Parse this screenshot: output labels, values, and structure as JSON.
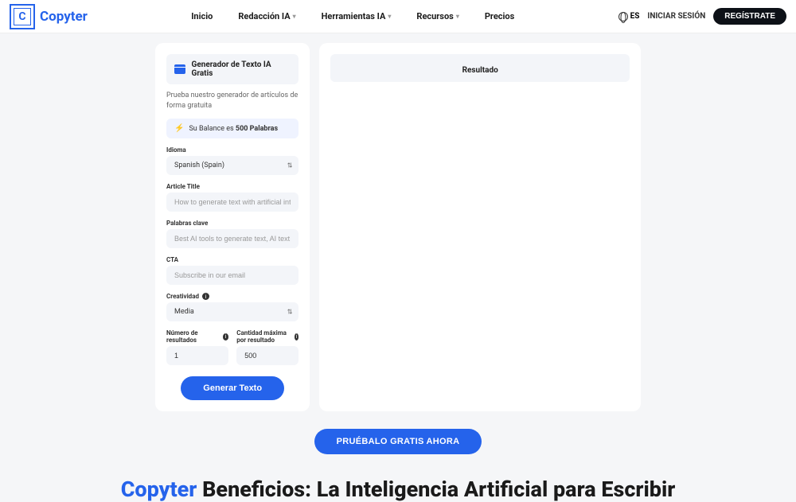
{
  "brand": {
    "letter": "C",
    "name": "Copyter"
  },
  "nav": {
    "inicio": "Inicio",
    "redaccion": "Redacción IA",
    "herramientas": "Herramientas IA",
    "recursos": "Recursos",
    "precios": "Precios"
  },
  "header_right": {
    "lang": "ES",
    "login": "INICIAR SESIÓN",
    "register": "REGÍSTRATE"
  },
  "generator": {
    "title": "Generador de Texto IA Gratis",
    "desc": "Prueba nuestro generador de artículos de forma gratuita",
    "balance_prefix": "Su Balance es ",
    "balance_value": "500 Palabras",
    "idioma_label": "Idioma",
    "idioma_value": "Spanish (Spain)",
    "article_title_label": "Article Title",
    "article_title_placeholder": "How to generate text with artificial intelligence",
    "keywords_label": "Palabras clave",
    "keywords_placeholder": "Best AI tools to generate text, AI text generator",
    "cta_label": "CTA",
    "cta_placeholder": "Subscribe in our email",
    "creativity_label": "Creatividad",
    "creativity_value": "Media",
    "results_label": "Número de resultados",
    "results_value": "1",
    "max_label": "Cantidad máxima por resultado",
    "max_value": "500",
    "generate_btn": "Generar Texto"
  },
  "result": {
    "title": "Resultado"
  },
  "cta_button": "PRUÉBALO GRATIS AHORA",
  "heading": {
    "brand": "Copyter",
    "rest": " Beneficios: La Inteligencia Artificial para Escribir"
  }
}
